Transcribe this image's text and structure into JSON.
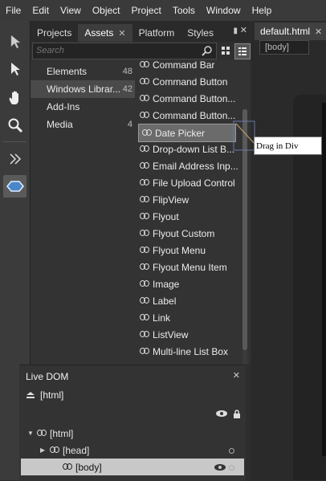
{
  "menubar": {
    "items": [
      "File",
      "Edit",
      "View",
      "Object",
      "Project",
      "Tools",
      "Window",
      "Help"
    ]
  },
  "toolbox": {
    "tools": [
      "selection-tool",
      "direct-select-tool",
      "pan-tool",
      "zoom-tool",
      "expand-tool",
      "assets-tool"
    ]
  },
  "panel": {
    "tabs": [
      {
        "label": "Projects"
      },
      {
        "label": "Assets",
        "close": "✕"
      },
      {
        "label": "Platform"
      },
      {
        "label": "Styles"
      }
    ],
    "pin": "▮",
    "close": "✕",
    "search": {
      "placeholder": "Search"
    },
    "categories": [
      {
        "label": "Elements",
        "count": "48"
      },
      {
        "label": "Windows Librar...",
        "count": "42"
      },
      {
        "label": "Add-Ins",
        "count": ""
      },
      {
        "label": "Media",
        "count": "4"
      }
    ],
    "items": [
      "Command Bar",
      "Command Button",
      "Command Button...",
      "Command Button...",
      "Date Picker",
      "Drop-down List B...",
      "Email Address Inp...",
      "File Upload Control",
      "FlipView",
      "Flyout",
      "Flyout Custom",
      "Flyout Menu",
      "Flyout Menu Item",
      "Image",
      "Label",
      "Link",
      "ListView",
      "Multi-line List Box"
    ],
    "selected_item_index": 4
  },
  "document": {
    "tab": "default.html",
    "tab_close": "✕",
    "breadcrumb": "[body]"
  },
  "drag_tooltip": "Drag in Div",
  "live_dom": {
    "title": "Live DOM",
    "close": "✕",
    "root_label": "[html]",
    "nodes": [
      {
        "label": "[html]",
        "expand": "▼"
      },
      {
        "label": "[head]",
        "expand": "▶"
      },
      {
        "label": "[body]",
        "expand": ""
      }
    ]
  },
  "colors": {
    "background": "#2d2d2d",
    "panel": "#333333",
    "selected": "#6b6b6b",
    "tooltip": "#ffffff"
  }
}
